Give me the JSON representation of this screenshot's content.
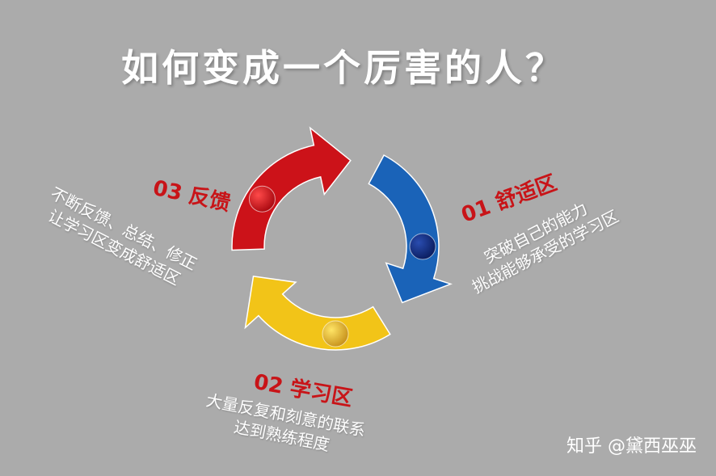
{
  "title": "如何变成一个厉害的人？",
  "stages": [
    {
      "label": "01 舒适区",
      "lines": [
        "突破自己的能力",
        "挑战能够承受的学习区"
      ],
      "color": "#1a63b8",
      "dot_color": "#0d2a7a"
    },
    {
      "label": "02 学习区",
      "lines": [
        "大量反复和刻意的联系",
        "达到熟练程度"
      ],
      "color": "#f2c418",
      "dot_color": "#d8a51a"
    },
    {
      "label": "03 反馈",
      "lines": [
        "不断反馈、总结、修正",
        "让学习区变成舒适区"
      ],
      "color": "#cc1219",
      "dot_color": "#c4101a"
    }
  ],
  "label_color": "#c81418",
  "watermark": "知乎 @黛西巫巫"
}
